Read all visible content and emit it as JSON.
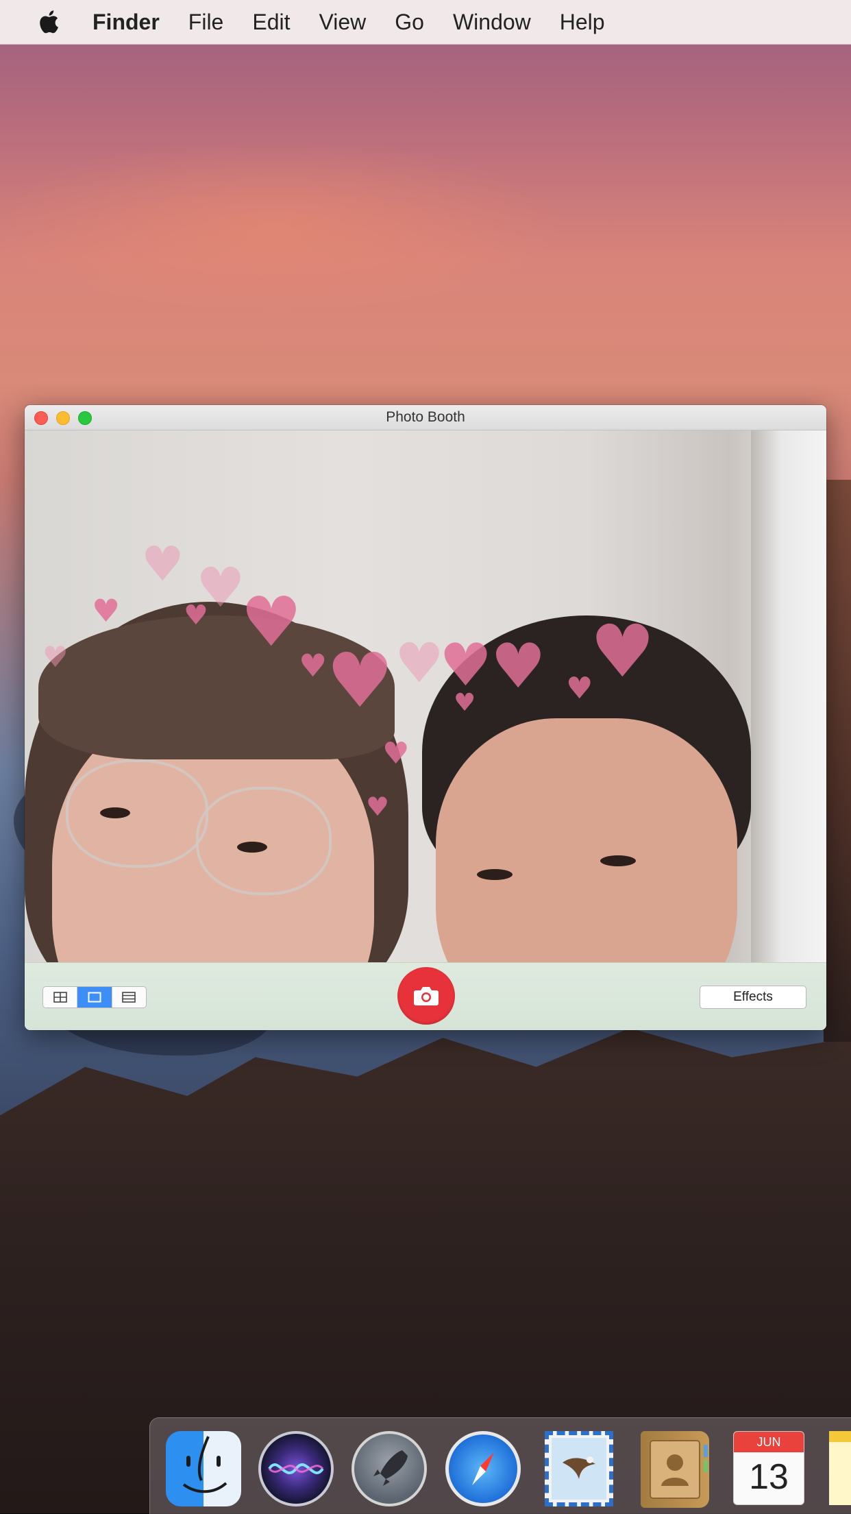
{
  "menubar": {
    "items": [
      "Finder",
      "File",
      "Edit",
      "View",
      "Go",
      "Window",
      "Help"
    ]
  },
  "window": {
    "title": "Photo Booth",
    "effects_label": "Effects",
    "view_modes": [
      "four-up",
      "single",
      "filmstrip"
    ],
    "active_view_mode": "single"
  },
  "dock": {
    "apps": [
      "Finder",
      "Siri",
      "Launchpad",
      "Safari",
      "Mail",
      "Contacts",
      "Calendar",
      "Notes"
    ],
    "calendar": {
      "month": "JUN",
      "day": "13"
    }
  },
  "colors": {
    "shutter": "#e8323b",
    "active_segment": "#3d8ef7",
    "close": "#fc5d55",
    "minimize": "#fdbc30",
    "zoom": "#28c940"
  }
}
